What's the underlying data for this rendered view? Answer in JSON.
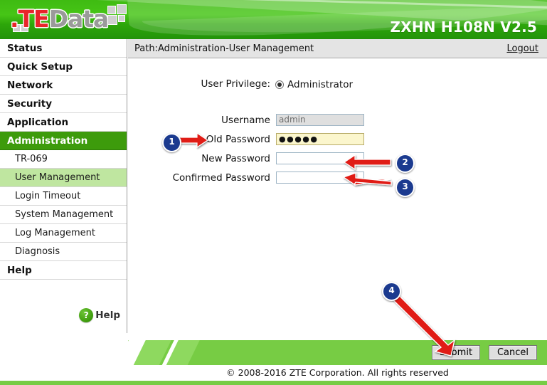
{
  "header": {
    "logo_te": ".TE",
    "logo_data": "Data",
    "model": "ZXHN H108N V2.5"
  },
  "sidebar": {
    "items": [
      {
        "label": "Status",
        "type": "top",
        "state": "normal"
      },
      {
        "label": "Quick Setup",
        "type": "top",
        "state": "normal"
      },
      {
        "label": "Network",
        "type": "top",
        "state": "normal"
      },
      {
        "label": "Security",
        "type": "top",
        "state": "normal"
      },
      {
        "label": "Application",
        "type": "top",
        "state": "normal"
      },
      {
        "label": "Administration",
        "type": "top",
        "state": "active"
      },
      {
        "label": "TR-069",
        "type": "sub",
        "state": "normal"
      },
      {
        "label": "User Management",
        "type": "sub",
        "state": "selected"
      },
      {
        "label": "Login Timeout",
        "type": "sub",
        "state": "normal"
      },
      {
        "label": "System Management",
        "type": "sub",
        "state": "normal"
      },
      {
        "label": "Log Management",
        "type": "sub",
        "state": "normal"
      },
      {
        "label": "Diagnosis",
        "type": "sub",
        "state": "normal"
      },
      {
        "label": "Help",
        "type": "top",
        "state": "normal"
      }
    ],
    "help_widget": {
      "icon": "question-mark-icon",
      "glyph": "?",
      "label": "Help"
    }
  },
  "pathbar": {
    "path": "Path:Administration-User Management",
    "logout": "Logout"
  },
  "form": {
    "privilege_label": "User Privilege:",
    "privilege_value": "Administrator",
    "fields": [
      {
        "label": "Username",
        "value": "admin",
        "placeholder": "",
        "state": "disabled"
      },
      {
        "label": "Old Password",
        "value": "●●●●●",
        "placeholder": "",
        "state": "autofill"
      },
      {
        "label": "New Password",
        "value": "",
        "placeholder": "",
        "state": "empty"
      },
      {
        "label": "Confirmed Password",
        "value": "",
        "placeholder": "",
        "state": "empty"
      }
    ]
  },
  "actions": {
    "submit_label": "Submit",
    "cancel_label": "Cancel"
  },
  "footer": {
    "copyright": "© 2008-2016 ZTE Corporation. All rights reserved"
  },
  "annotations": {
    "badges": [
      {
        "number": "1",
        "target": "old-password-field"
      },
      {
        "number": "2",
        "target": "new-password-field"
      },
      {
        "number": "3",
        "target": "confirmed-password-field"
      },
      {
        "number": "4",
        "target": "submit-button"
      }
    ],
    "arrow_color": "#e01b16",
    "badge_color": "#1b3a8f"
  }
}
